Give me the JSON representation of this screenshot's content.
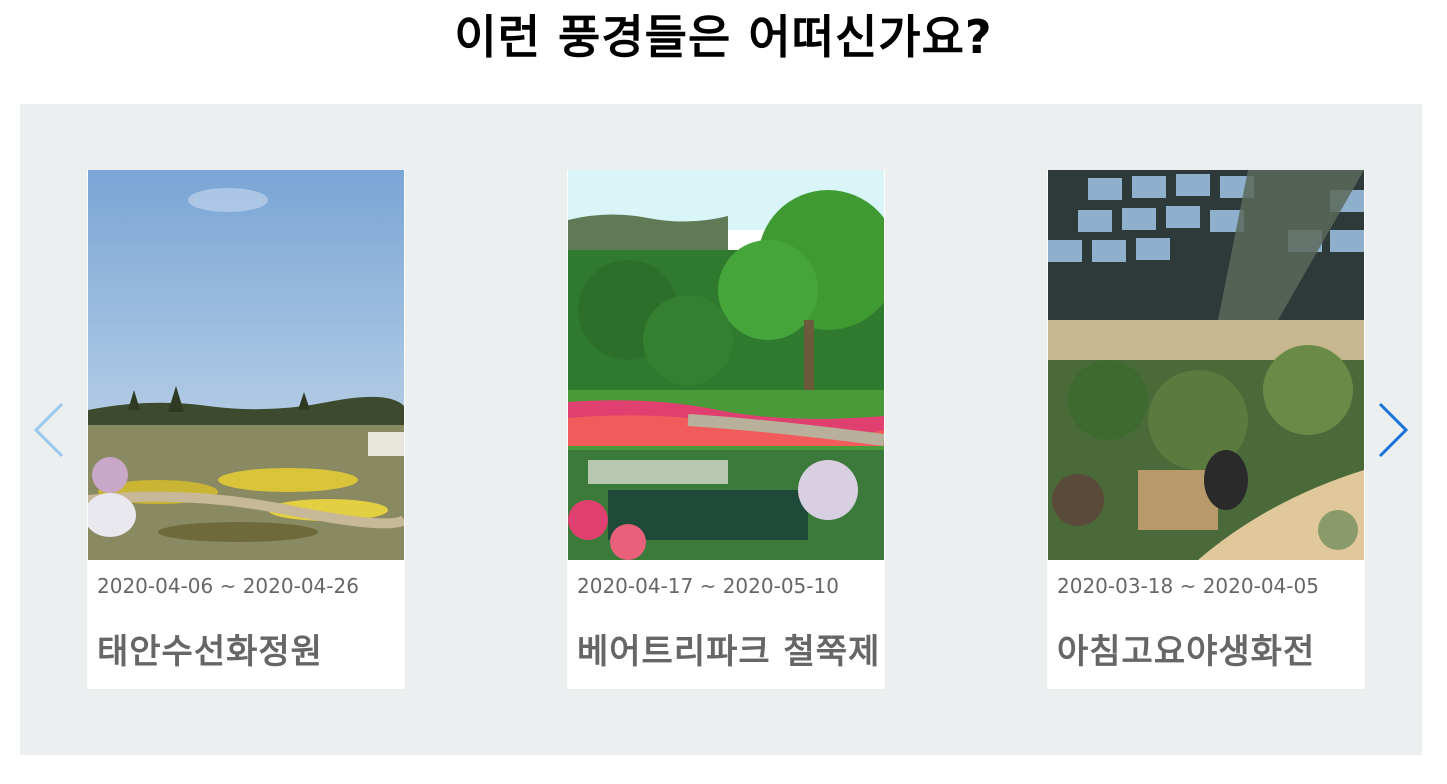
{
  "section": {
    "title": "이런 풍경들은 어떠신가요?"
  },
  "carousel": {
    "prev_icon": "chevron-left-icon",
    "next_icon": "chevron-right-icon",
    "colors": {
      "background": "#ebeff0",
      "prev_arrow": "#9cc8ef",
      "next_arrow": "#1a73d9",
      "text": "#666666"
    },
    "cards": [
      {
        "date": "2020-04-06 ~ 2020-04-26",
        "name": "태안수선화정원"
      },
      {
        "date": "2020-04-17 ~ 2020-05-10",
        "name": "베어트리파크 철쭉제"
      },
      {
        "date": "2020-03-18 ~ 2020-04-05",
        "name": "아침고요야생화전"
      }
    ]
  }
}
